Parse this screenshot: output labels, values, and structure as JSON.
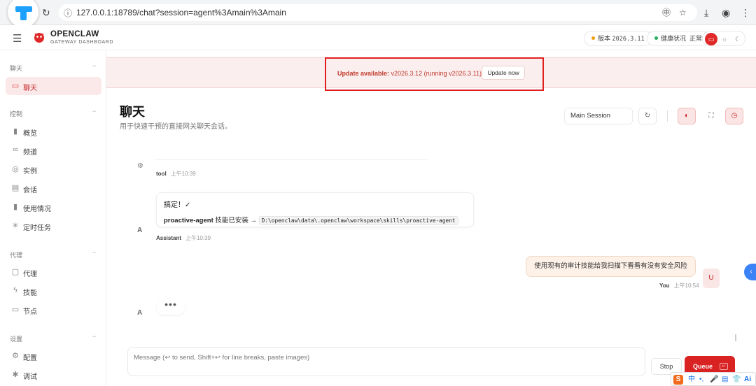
{
  "browser": {
    "url": "127.0.0.1:18789/chat?session=agent%3Amain%3Amain",
    "info_icon": "info-icon"
  },
  "header": {
    "brand_title": "OPENCLAW",
    "brand_subtitle": "GATEWAY DASHBOARD",
    "version_label": "版本",
    "version_value": "2026.3.11",
    "health_label": "健康状况",
    "health_value": "正常",
    "colors": {
      "version_dot": "#f39c12",
      "health_dot": "#27ae60",
      "accent": "#d92323"
    }
  },
  "sidebar": {
    "sections": [
      {
        "title": "聊天",
        "items": [
          {
            "label": "聊天",
            "icon": "chat-icon",
            "active": true
          }
        ]
      },
      {
        "title": "控制",
        "items": [
          {
            "label": "概览",
            "icon": "bar-chart-icon"
          },
          {
            "label": "频道",
            "icon": "link-icon"
          },
          {
            "label": "实例",
            "icon": "radio-icon"
          },
          {
            "label": "会话",
            "icon": "document-icon"
          },
          {
            "label": "使用情况",
            "icon": "bar-chart-icon"
          },
          {
            "label": "定时任务",
            "icon": "loader-icon"
          }
        ]
      },
      {
        "title": "代理",
        "items": [
          {
            "label": "代理",
            "icon": "folder-icon"
          },
          {
            "label": "技能",
            "icon": "zap-icon"
          },
          {
            "label": "节点",
            "icon": "monitor-icon"
          }
        ]
      },
      {
        "title": "设置",
        "items": [
          {
            "label": "配置",
            "icon": "gear-icon"
          },
          {
            "label": "调试",
            "icon": "bug-icon"
          }
        ]
      }
    ],
    "collapse_glyph": "−"
  },
  "banner": {
    "prefix": "Update available:",
    "message": " v2026.3.12 (running v2026.3.11).",
    "button": "Update now"
  },
  "page": {
    "title": "聊天",
    "subtitle": "用于快速干预的直接网关聊天会话。",
    "session": "Main Session"
  },
  "messages": {
    "tool": {
      "sender": "tool",
      "time": "上午10:39"
    },
    "assistant": {
      "line1": "搞定！✓",
      "skill": "proactive-agent",
      "text": " 技能已安装 → ",
      "path": "D:\\openclaw\\data\\.openclaw\\workspace\\skills\\proactive-agent",
      "sender": "Assistant",
      "time": "上午10:39",
      "avatar": "A"
    },
    "user": {
      "text": "使用现有的审计技能给我扫描下看看有没有安全风险",
      "sender": "You",
      "time": "上午10:54",
      "avatar": "U"
    },
    "typing": {
      "avatar": "A",
      "dots": "•••"
    }
  },
  "composer": {
    "placeholder": "Message (↩ to send, Shift+↩ for line breaks, paste images)",
    "stop": "Stop",
    "queue": "Queue",
    "queue_kbd": "↵"
  },
  "ime": {
    "brand": "S",
    "items": [
      "中",
      "•,",
      "🎤",
      "▤",
      "👕",
      "Ai"
    ]
  }
}
